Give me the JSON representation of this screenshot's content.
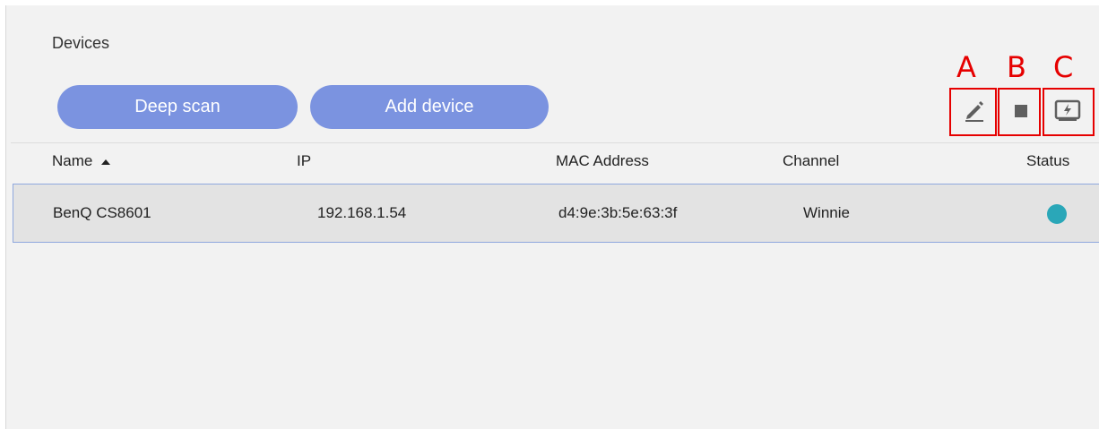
{
  "page": {
    "title": "Devices"
  },
  "toolbar": {
    "deep_scan_label": "Deep scan",
    "add_device_label": "Add device",
    "icons": [
      "edit-icon",
      "stop-icon",
      "screen-flash-icon"
    ]
  },
  "annotations": {
    "a": "A",
    "b": "B",
    "c": "C",
    "color": "#e60000"
  },
  "table": {
    "columns": [
      "Name",
      "IP",
      "MAC Address",
      "Channel",
      "Status"
    ],
    "sort_column": "Name",
    "rows": [
      {
        "name": "BenQ CS8601",
        "ip": "192.168.1.54",
        "mac": "d4:9e:3b:5e:63:3f",
        "channel": "Winnie",
        "status_color": "#2aa7b8"
      }
    ]
  },
  "colors": {
    "button": "#7b93e0",
    "row_selected_border": "#8fa8de"
  }
}
